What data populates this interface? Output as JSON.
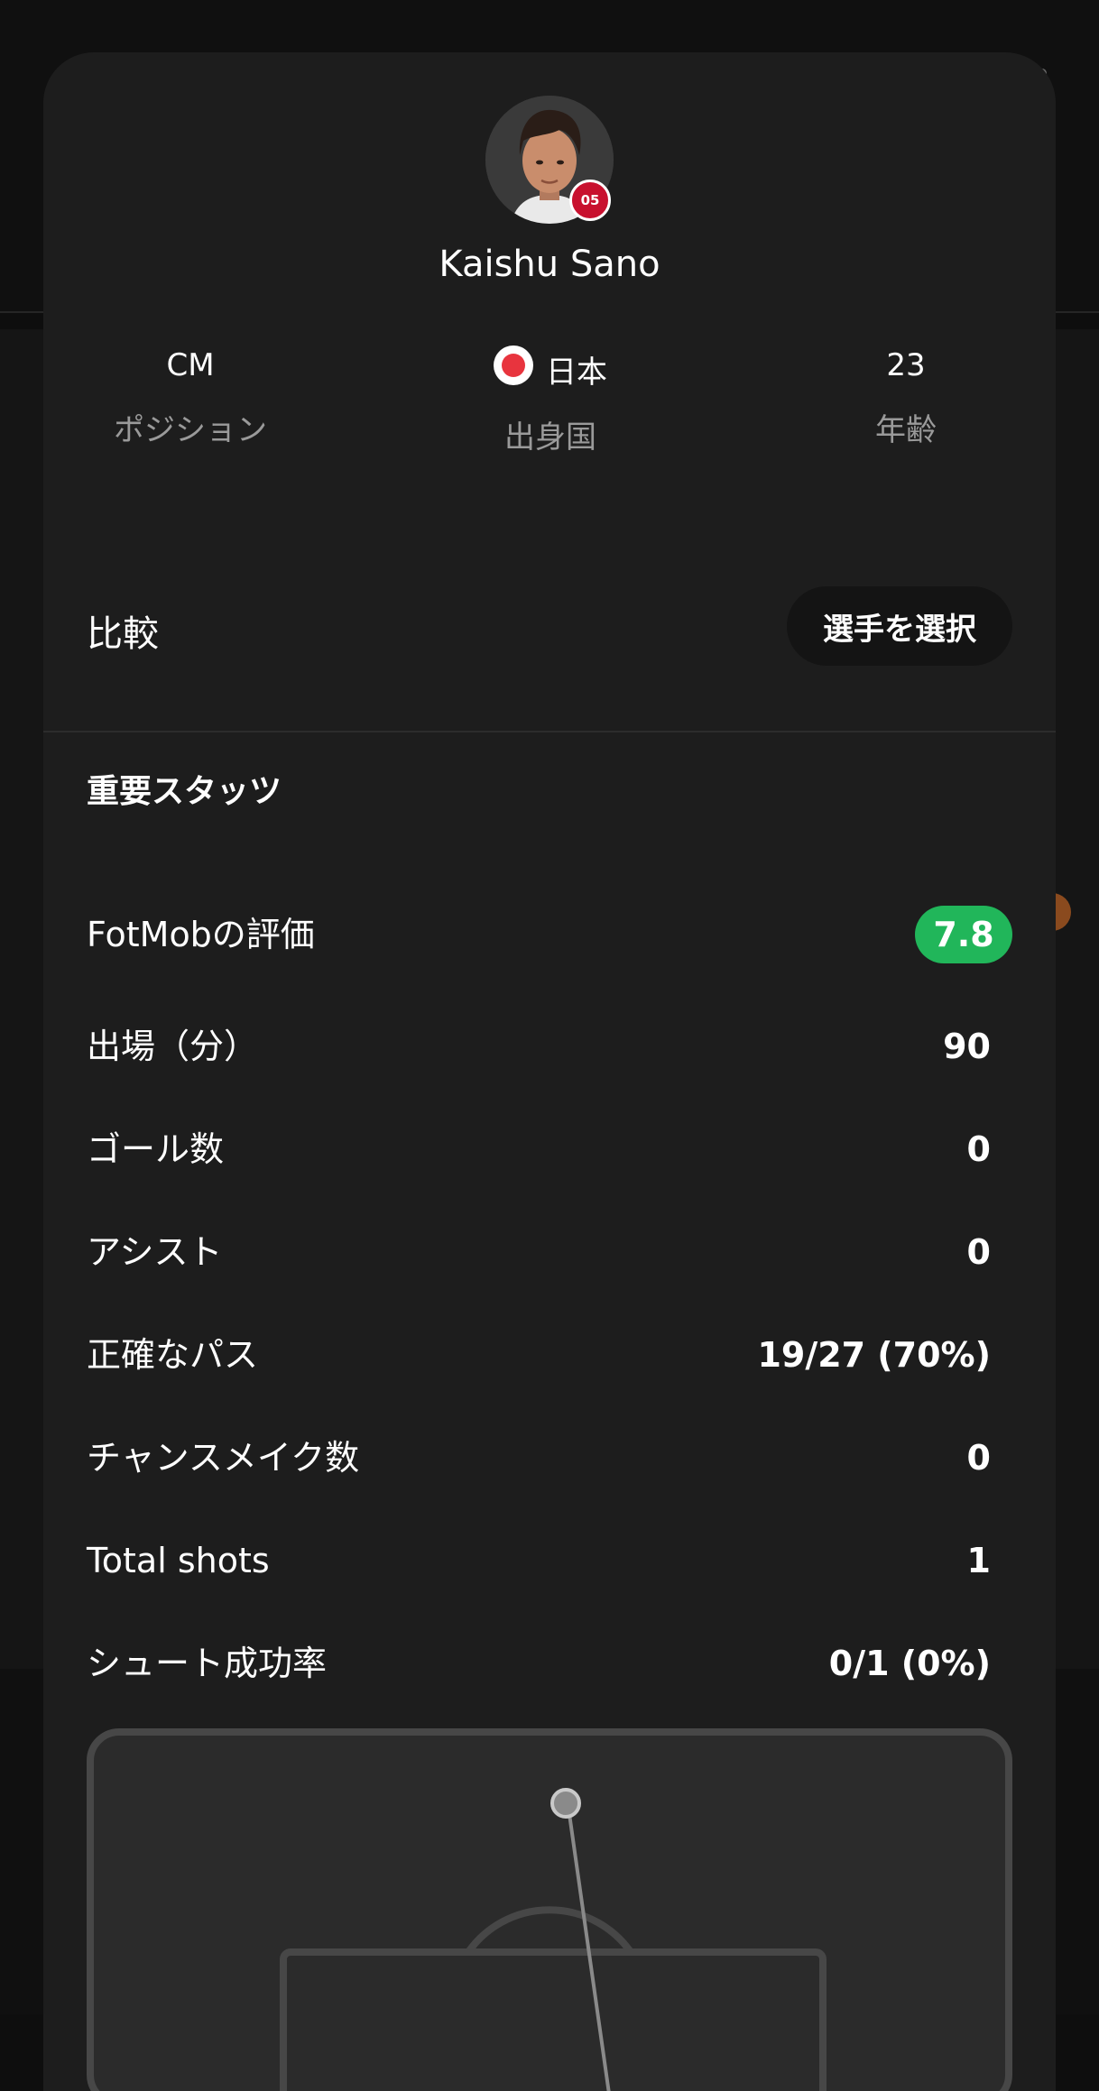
{
  "player": {
    "name": "Kaishu Sano",
    "avatar_icon": "player-photo",
    "club_badge_icon": "club-crest-icon",
    "club_badge_text": "05"
  },
  "info": {
    "position": {
      "value": "CM",
      "label": "ポジション"
    },
    "country": {
      "value": "日本",
      "label": "出身国",
      "flag_icon": "japan-flag-icon"
    },
    "age": {
      "value": "23",
      "label": "年齢"
    }
  },
  "compare": {
    "label": "比較",
    "button_label": "選手を選択"
  },
  "key_stats": {
    "title": "重要スタッツ",
    "rating_color": "#21b65a",
    "rows": [
      {
        "label": "FotMobの評価",
        "value": "7.8"
      },
      {
        "label": "出場（分）",
        "value": "90"
      },
      {
        "label": "ゴール数",
        "value": "0"
      },
      {
        "label": "アシスト",
        "value": "0"
      },
      {
        "label": "正確なパス",
        "value": "19/27 (70%)"
      },
      {
        "label": "チャンスメイク数",
        "value": "0"
      },
      {
        "label": "Total shots",
        "value": "1"
      },
      {
        "label": "シュート成功率",
        "value": "0/1 (0%)"
      }
    ]
  },
  "shot_map": {
    "shots": [
      {
        "outcome": "missed"
      }
    ]
  }
}
